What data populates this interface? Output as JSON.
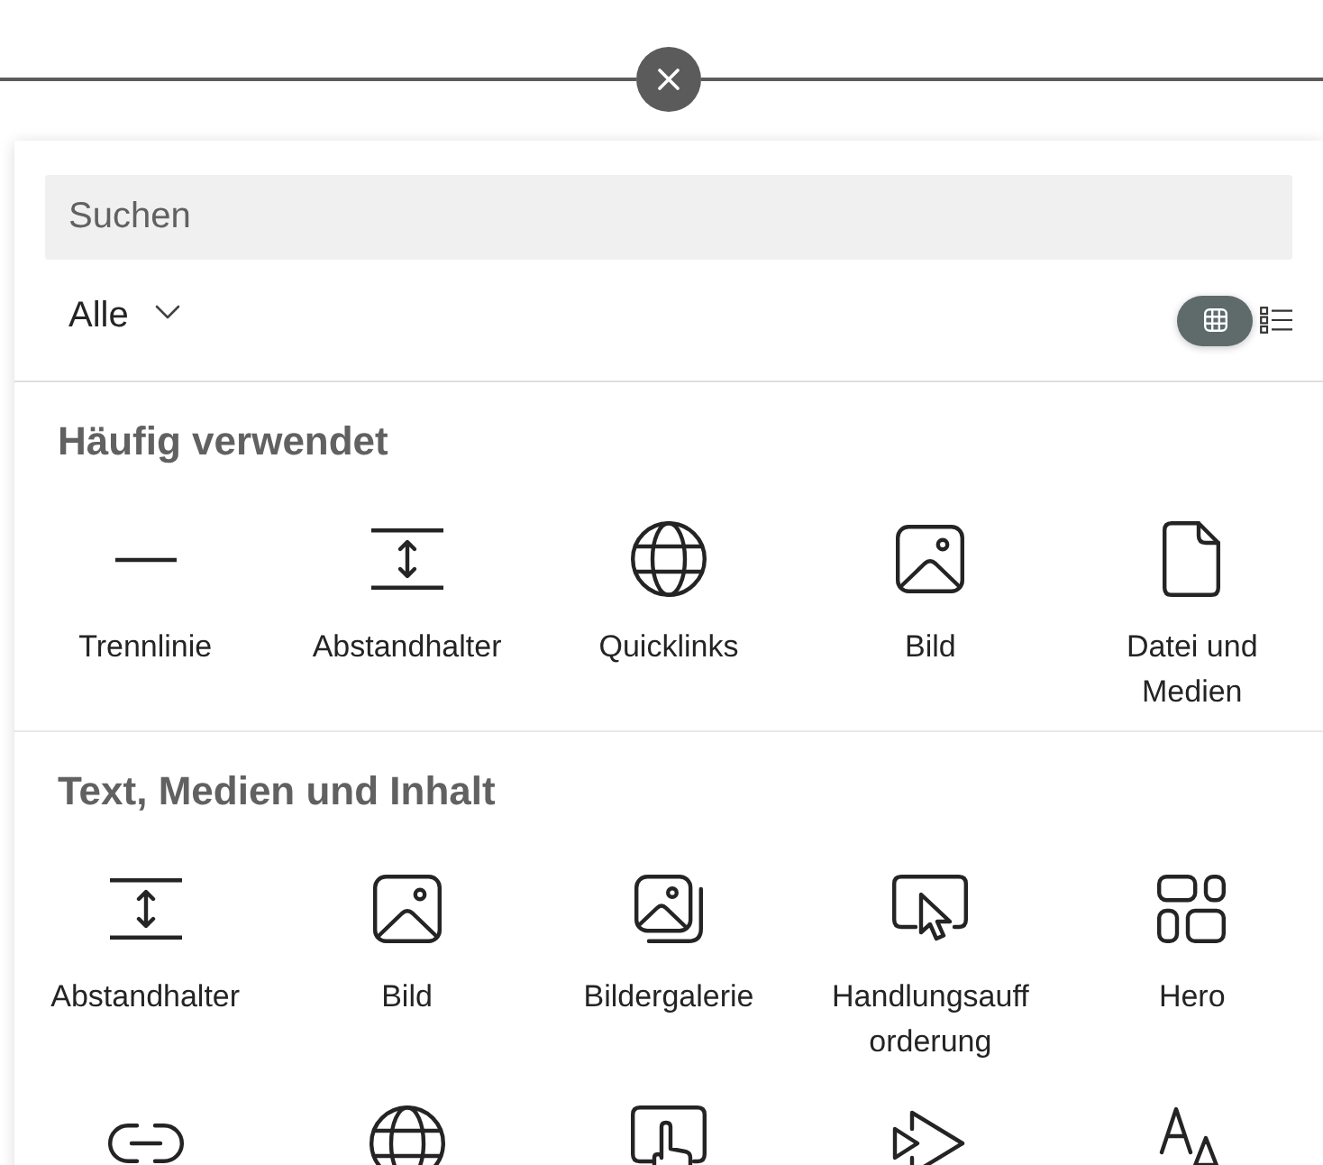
{
  "search": {
    "placeholder": "Suchen"
  },
  "filter": {
    "value": "Alle"
  },
  "view_toggle": [
    {
      "kind": "grid",
      "selected": true
    },
    {
      "kind": "list",
      "selected": false
    }
  ],
  "sections": [
    {
      "title": "Häufig verwendet",
      "items": [
        {
          "kind": "divider",
          "label": "Trennlinie"
        },
        {
          "kind": "spacer",
          "label": "Abstandhalter"
        },
        {
          "kind": "globe",
          "label": "Quicklinks"
        },
        {
          "kind": "image",
          "label": "Bild"
        },
        {
          "kind": "file",
          "label": "Datei und Medien"
        }
      ]
    },
    {
      "title": "Text, Medien und Inhalt",
      "items": [
        {
          "kind": "spacer",
          "label": "Abstandhalter"
        },
        {
          "kind": "image",
          "label": "Bild"
        },
        {
          "kind": "gallery",
          "label": "Bildergalerie"
        },
        {
          "kind": "cursor",
          "label": "Handlungsaufforderung"
        },
        {
          "kind": "hero",
          "label": "Hero"
        },
        {
          "kind": "link"
        },
        {
          "kind": "globe"
        },
        {
          "kind": "touch"
        },
        {
          "kind": "forward"
        },
        {
          "kind": "font"
        }
      ]
    }
  ]
}
